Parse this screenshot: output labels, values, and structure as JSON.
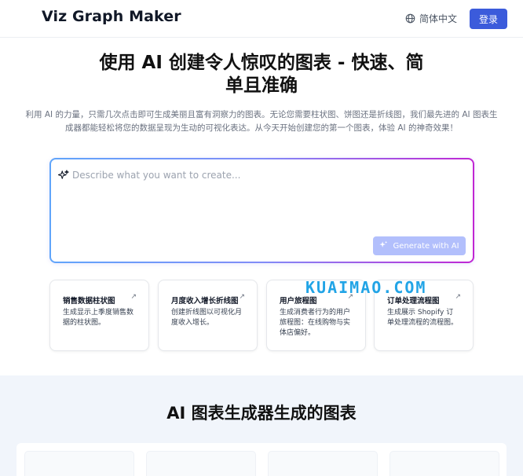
{
  "header": {
    "logo": "Viz Graph Maker",
    "language_label": "简体中文",
    "login_label": "登录"
  },
  "hero": {
    "title": "使用 AI 创建令人惊叹的图表 - 快速、简单且准确",
    "description": "利用 AI 的力量，只需几次点击即可生成美丽且富有洞察力的图表。无论您需要柱状图、饼图还是折线图，我们最先进的 AI 图表生成器都能轻松将您的数据呈现为生动的可视化表达。从今天开始创建您的第一个图表，体验 AI 的神奇效果！"
  },
  "prompt": {
    "placeholder": "Describe what you want to create...",
    "generate_label": "Generate with AI"
  },
  "examples": [
    {
      "title": "销售数据柱状图",
      "description": "生成显示上季度销售数据的柱状图。"
    },
    {
      "title": "月度收入增长折线图",
      "description": "创建折线图以可视化月度收入增长。"
    },
    {
      "title": "用户旅程图",
      "description": "生成消费者行为的用户旅程图：在线购物与实体店偏好。"
    },
    {
      "title": "订单处理流程图",
      "description": "生成展示 Shopify 订单处理流程的流程图。"
    }
  ],
  "watermark": "KUAIMAO.COM",
  "gallery": {
    "title": "AI 图表生成器生成的图表"
  },
  "colors": {
    "accent": "#3b5bdb",
    "generate_disabled": "#a5b4fc",
    "section_bg": "#f1f5fb"
  }
}
